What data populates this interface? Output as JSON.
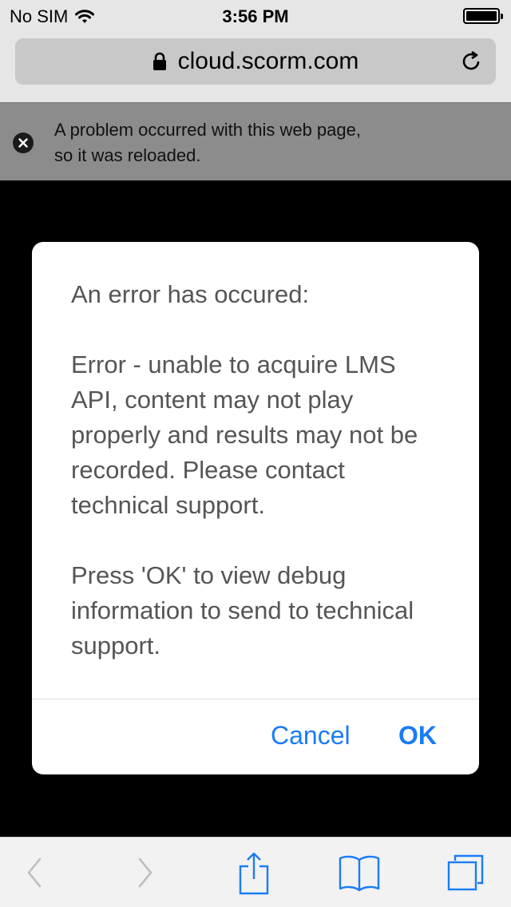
{
  "status_bar": {
    "carrier": "No SIM",
    "time": "3:56 PM",
    "icons": [
      "wifi-icon",
      "battery-icon"
    ]
  },
  "browser": {
    "url": "cloud.scorm.com",
    "icons": [
      "lock-icon",
      "reload-icon"
    ]
  },
  "notice": {
    "line1": "A problem occurred with this web page,",
    "line2": "so it was reloaded.",
    "icon": "close-circle-icon"
  },
  "dialog": {
    "title": "An error has occured:",
    "message": "Error - unable to acquire LMS API, content may not play properly and results may not be recorded.  Please contact technical support.",
    "prompt": "Press 'OK' to view debug information to send to technical support.",
    "cancel_label": "Cancel",
    "ok_label": "OK"
  },
  "toolbar": {
    "icons": [
      "back-icon",
      "forward-icon",
      "share-icon",
      "bookmarks-icon",
      "tabs-icon"
    ]
  },
  "colors": {
    "accent": "#1a7cf5",
    "dialog_text": "#555555",
    "notice_bg": "#8c8c8c",
    "chrome_bg": "#e6e6e6"
  }
}
